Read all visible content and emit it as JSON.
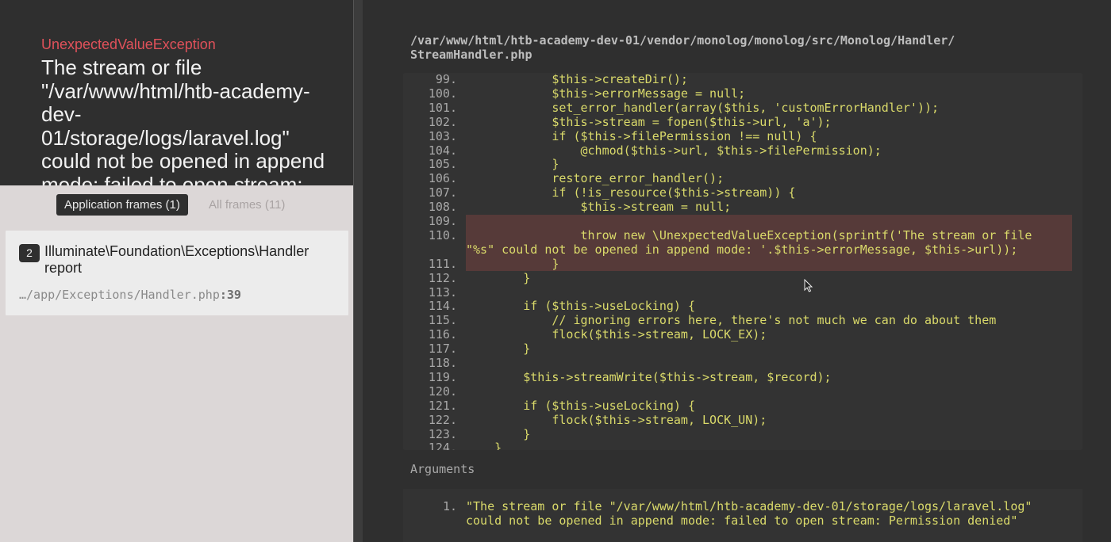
{
  "exception": {
    "class": "UnexpectedValueException",
    "message": "The stream or file \"/var/www/html/htb-academy-dev-01/storage/logs/laravel.log\" could not be opened in append mode: failed to open stream: Permission denied"
  },
  "tabs": {
    "application": "Application frames (1)",
    "all": "All frames (11)"
  },
  "frame": {
    "index": "2",
    "class": "Illuminate\\Foundation\\Exceptions\\Handler report",
    "file": "…/app/Exceptions/Handler.php",
    "line": ":39"
  },
  "code": {
    "file_path": "/var/www/html/htb-academy-dev-01/vendor/monolog/monolog/src/Monolog/Handler/\nStreamHandler.php",
    "lines": [
      {
        "n": "99.",
        "t": "            $this->createDir();"
      },
      {
        "n": "100.",
        "t": "            $this->errorMessage = null;"
      },
      {
        "n": "101.",
        "t": "            set_error_handler(array($this, 'customErrorHandler'));"
      },
      {
        "n": "102.",
        "t": "            $this->stream = fopen($this->url, 'a');"
      },
      {
        "n": "103.",
        "t": "            if ($this->filePermission !== null) {"
      },
      {
        "n": "104.",
        "t": "                @chmod($this->url, $this->filePermission);"
      },
      {
        "n": "105.",
        "t": "            }"
      },
      {
        "n": "106.",
        "t": "            restore_error_handler();"
      },
      {
        "n": "107.",
        "t": "            if (!is_resource($this->stream)) {"
      },
      {
        "n": "108.",
        "t": "                $this->stream = null;"
      },
      {
        "n": "109.",
        "t": ""
      },
      {
        "n": "110.",
        "t": "                throw new \\UnexpectedValueException(sprintf('The stream or file",
        "t2": "\"%s\" could not be opened in append mode: '.$this->errorMessage, $this->url));"
      },
      {
        "n": "111.",
        "t": "            }"
      },
      {
        "n": "112.",
        "t": "        }"
      },
      {
        "n": "113.",
        "t": ""
      },
      {
        "n": "114.",
        "t": "        if ($this->useLocking) {"
      },
      {
        "n": "115.",
        "t": "            // ignoring errors here, there's not much we can do about them"
      },
      {
        "n": "116.",
        "t": "            flock($this->stream, LOCK_EX);"
      },
      {
        "n": "117.",
        "t": "        }"
      },
      {
        "n": "118.",
        "t": ""
      },
      {
        "n": "119.",
        "t": "        $this->streamWrite($this->stream, $record);"
      },
      {
        "n": "120.",
        "t": ""
      },
      {
        "n": "121.",
        "t": "        if ($this->useLocking) {"
      },
      {
        "n": "122.",
        "t": "            flock($this->stream, LOCK_UN);"
      },
      {
        "n": "123.",
        "t": "        }"
      },
      {
        "n": "124.",
        "t": "    }"
      }
    ]
  },
  "arguments": {
    "label": "Arguments",
    "items": [
      {
        "n": "1.",
        "value": "\"The stream or file \"/var/www/html/htb-academy-dev-01/storage/logs/laravel.log\"\ncould not be opened in append mode: failed to open stream: Permission denied\""
      }
    ]
  },
  "colors": {
    "exception_class": "#e0515a",
    "code_text": "#dada6a",
    "highlight": "#563a39"
  }
}
